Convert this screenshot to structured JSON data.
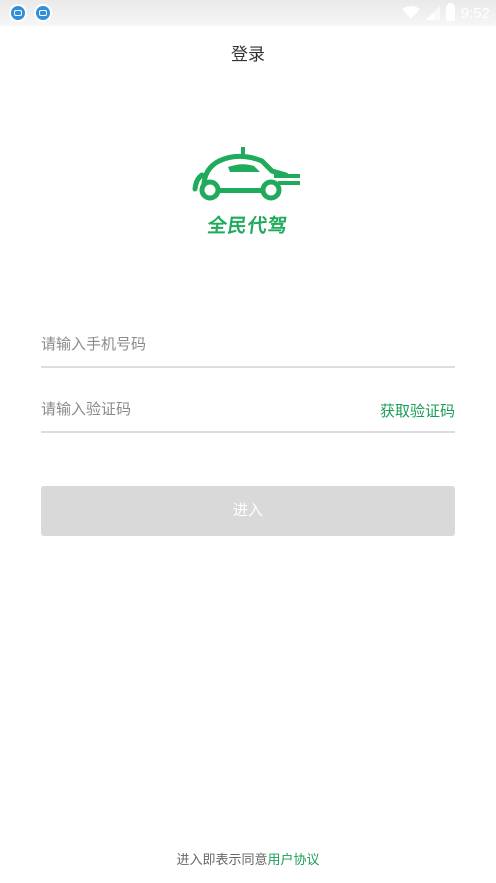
{
  "status_bar": {
    "time": "9:52",
    "icons": [
      "app-notification-icon",
      "app-notification-icon",
      "wifi-icon",
      "signal-icon",
      "battery-charging-icon"
    ]
  },
  "header": {
    "title": "登录"
  },
  "logo": {
    "text": "全民代驾",
    "icon": "car-logo-icon",
    "brand_color": "#1faa5c"
  },
  "form": {
    "phone_placeholder": "请输入手机号码",
    "phone_value": "",
    "code_placeholder": "请输入验证码",
    "code_value": "",
    "get_code_label": "获取验证码",
    "submit_label": "进入"
  },
  "footer": {
    "agreement_prefix": "进入即表示同意",
    "agreement_link": "用户协议"
  },
  "colors": {
    "accent": "#1a9e55",
    "button_disabled": "#d9d9d9"
  }
}
